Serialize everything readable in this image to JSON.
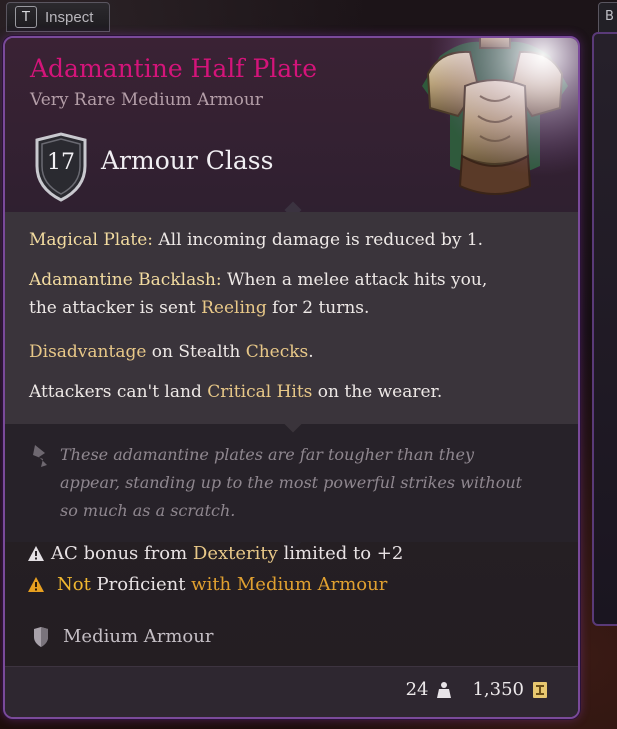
{
  "inspect": {
    "key": "T",
    "label": "Inspect"
  },
  "side_tab": {
    "key": "B"
  },
  "item": {
    "name": "Adamantine Half Plate",
    "subtitle": "Very Rare Medium Armour",
    "ac_value": "17",
    "ac_label": "Armour Class",
    "image": "adamantine-half-plate-armour",
    "rarity_color": "#d4147a",
    "frame_color": "#7a4a9a"
  },
  "effects": {
    "magical_plate": {
      "title": "Magical Plate:",
      "text": " All incoming damage is reduced by 1."
    },
    "backlash": {
      "title": "Adamantine Backlash:",
      "text1": " When a melee attack hits you,",
      "text2a": "the attacker is sent ",
      "reeling": "Reeling",
      "text2b": " for 2 turns."
    },
    "stealth": {
      "kw1": "Disadvantage",
      "mid": " on Stealth ",
      "kw2": "Checks",
      "end": "."
    },
    "crit": {
      "start": "Attackers can't land ",
      "kw": "Critical Hits",
      "end": " on the wearer."
    }
  },
  "flavor": {
    "icon": "quill-icon",
    "text": "These adamantine plates are far tougher than they appear, standing up to the most powerful strikes without so much as a scratch."
  },
  "requirements": {
    "dex": {
      "icon": "warning-icon",
      "start": "AC bonus from ",
      "kw": "Dexterity",
      "end": " limited to +2"
    },
    "prof": {
      "icon": "warning-orange-icon",
      "not": "Not",
      "start": " Proficient ",
      "kw": "with Medium Armour"
    }
  },
  "armour_type": {
    "icon": "shield-small-icon",
    "label": "Medium Armour"
  },
  "footer": {
    "weight": "24",
    "weight_icon": "weight-icon",
    "price": "1,350",
    "price_icon": "gold-coin-icon"
  }
}
